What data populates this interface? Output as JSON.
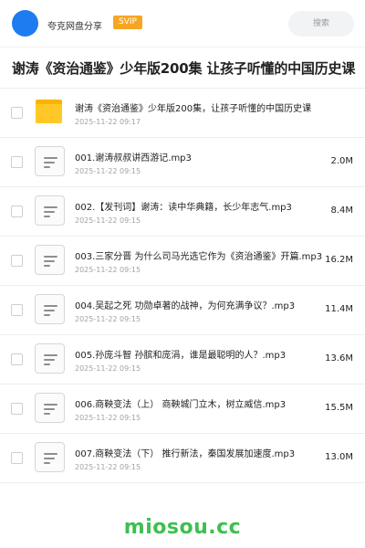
{
  "header": {
    "brand": "夸克网盘分享",
    "badge": "SVIP",
    "search_placeholder": "搜索"
  },
  "page_title": "谢涛《资治通鉴》少年版200集 让孩子听懂的中国历史课",
  "files": [
    {
      "type": "folder",
      "name": "谢涛《资治通鉴》少年版200集，让孩子听懂的中国历史课",
      "date": "2025-11-22 09:17",
      "size": ""
    },
    {
      "type": "file",
      "name": "001.谢涛叔叔讲西游记.mp3",
      "date": "2025-11-22 09:15",
      "size": "2.0M"
    },
    {
      "type": "file",
      "name": "002.【发刊词】谢涛：读中华典籍，长少年志气.mp3",
      "date": "2025-11-22 09:15",
      "size": "8.4M"
    },
    {
      "type": "file",
      "name": "003.三家分晋  为什么司马光选它作为《资治通鉴》开篇.mp3",
      "date": "2025-11-22 09:15",
      "size": "16.2M"
    },
    {
      "type": "file",
      "name": "004.吴起之死  功勋卓著的战神，为何充满争议？.mp3",
      "date": "2025-11-22 09:15",
      "size": "11.4M"
    },
    {
      "type": "file",
      "name": "005.孙庞斗智  孙膑和庞涓，谁是最聪明的人？.mp3",
      "date": "2025-11-22 09:15",
      "size": "13.6M"
    },
    {
      "type": "file",
      "name": "006.商鞅变法（上）  商鞅城门立木，树立威信.mp3",
      "date": "2025-11-22 09:15",
      "size": "15.5M"
    },
    {
      "type": "file",
      "name": "007.商鞅变法（下）  推行新法，秦国发展加速度.mp3",
      "date": "2025-11-22 09:15",
      "size": "13.0M"
    }
  ],
  "watermark": "miosou.cc",
  "colors": {
    "accent": "#1e7bf0",
    "badge": "#f6a623",
    "folder": "#ffc826",
    "watermark": "#3fbe51"
  }
}
